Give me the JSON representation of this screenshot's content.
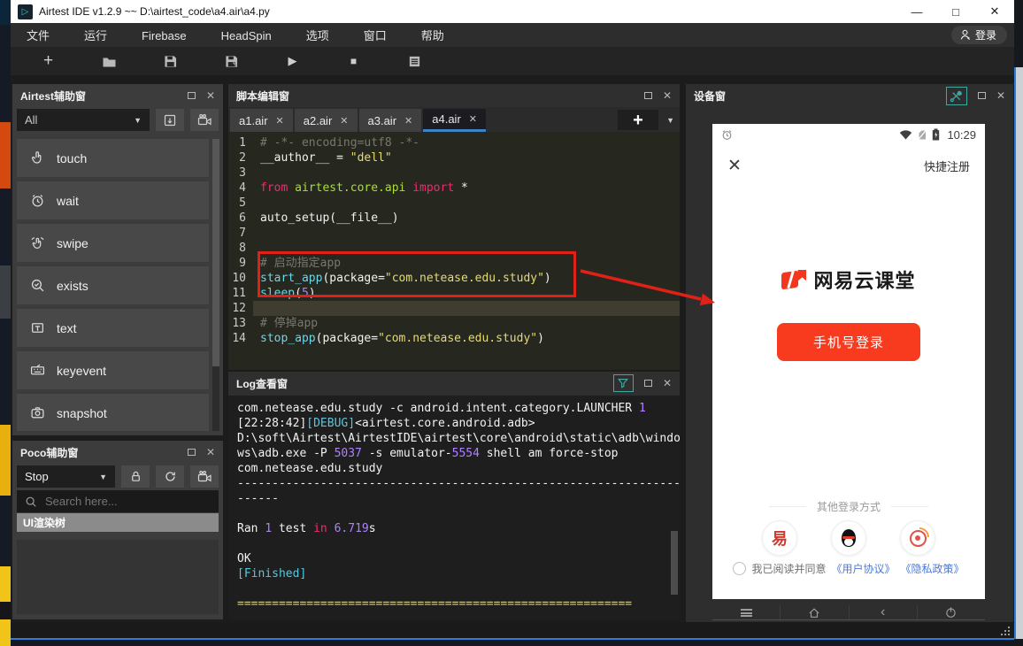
{
  "colors": {
    "accent_red": "#f83b1e",
    "annotation_red": "#df2118",
    "link_blue": "#4b79d9",
    "tab_underline": "#3d84c6",
    "teal_icon": "#3fa8a0"
  },
  "titlebar": {
    "title": "Airtest IDE v1.2.9 ~~ D:\\airtest_code\\a4.air\\a4.py"
  },
  "menu": {
    "items": [
      "文件",
      "运行",
      "Firebase",
      "HeadSpin",
      "选项",
      "窗口",
      "帮助"
    ],
    "login_label": "登录"
  },
  "toolbar": {
    "buttons": [
      "new-script",
      "open-folder",
      "save",
      "save-as",
      "run-script",
      "stop-script",
      "view-report"
    ]
  },
  "airtest_panel": {
    "title": "Airtest辅助窗",
    "filter_value": "All",
    "actions": [
      {
        "label": "touch",
        "icon": "touch-icon"
      },
      {
        "label": "wait",
        "icon": "wait-icon"
      },
      {
        "label": "swipe",
        "icon": "swipe-icon"
      },
      {
        "label": "exists",
        "icon": "exists-icon"
      },
      {
        "label": "text",
        "icon": "text-icon"
      },
      {
        "label": "keyevent",
        "icon": "keyevent-icon"
      },
      {
        "label": "snapshot",
        "icon": "snapshot-icon"
      }
    ]
  },
  "poco_panel": {
    "title": "Poco辅助窗",
    "mode_value": "Stop",
    "search_placeholder": "Search here...",
    "tree_header": "UI渲染树"
  },
  "editor": {
    "title": "脚本编辑窗",
    "tabs": [
      {
        "label": "a1.air",
        "active": false
      },
      {
        "label": "a2.air",
        "active": false
      },
      {
        "label": "a3.air",
        "active": false
      },
      {
        "label": "a4.air",
        "active": true
      }
    ],
    "code": [
      {
        "no": 1,
        "segs": [
          [
            "comment",
            "# -*- encoding=utf8 -*-"
          ]
        ]
      },
      {
        "no": 2,
        "segs": [
          [
            "plain",
            "__author__ = "
          ],
          [
            "str",
            "\"dell\""
          ]
        ]
      },
      {
        "no": 3,
        "segs": []
      },
      {
        "no": 4,
        "segs": [
          [
            "kw",
            "from"
          ],
          [
            "plain",
            " "
          ],
          [
            "mod",
            "airtest.core.api"
          ],
          [
            "plain",
            " "
          ],
          [
            "kw",
            "import"
          ],
          [
            "plain",
            " *"
          ]
        ]
      },
      {
        "no": 5,
        "segs": []
      },
      {
        "no": 6,
        "segs": [
          [
            "plain",
            "auto_setup(__file__)"
          ]
        ]
      },
      {
        "no": 7,
        "segs": []
      },
      {
        "no": 8,
        "segs": []
      },
      {
        "no": 9,
        "segs": [
          [
            "comment",
            "# 启动指定app"
          ]
        ]
      },
      {
        "no": 10,
        "segs": [
          [
            "fn",
            "start_app"
          ],
          [
            "plain",
            "(package="
          ],
          [
            "str",
            "\"com.netease.edu.study\""
          ],
          [
            "plain",
            ")"
          ]
        ]
      },
      {
        "no": 11,
        "segs": [
          [
            "fn",
            "sleep"
          ],
          [
            "plain",
            "("
          ],
          [
            "num",
            "5"
          ],
          [
            "plain",
            ")"
          ]
        ]
      },
      {
        "no": 12,
        "segs": [],
        "hl": true
      },
      {
        "no": 13,
        "segs": [
          [
            "comment",
            "# 停掉app"
          ]
        ]
      },
      {
        "no": 14,
        "segs": [
          [
            "fn",
            "stop_app"
          ],
          [
            "plain",
            "(package="
          ],
          [
            "str",
            "\"com.netease.edu.study\""
          ],
          [
            "plain",
            ")"
          ]
        ]
      }
    ]
  },
  "log": {
    "title": "Log查看窗",
    "lines": [
      [
        [
          "plain",
          "com.netease.edu.study -c android.intent.category.LAUNCHER "
        ],
        [
          "num",
          "1"
        ]
      ],
      [
        [
          "plain",
          "[22:28:42]"
        ],
        [
          "debug",
          "[DEBUG]"
        ],
        [
          "plain",
          "<airtest.core.android.adb>"
        ]
      ],
      [
        [
          "plain",
          "D:\\soft\\Airtest\\AirtestIDE\\airtest\\core\\android\\static\\adb\\windo"
        ]
      ],
      [
        [
          "plain",
          "ws\\adb.exe -P "
        ],
        [
          "num",
          "5037"
        ],
        [
          "plain",
          " -s emulator-"
        ],
        [
          "num",
          "5554"
        ],
        [
          "plain",
          " shell am force-stop"
        ]
      ],
      [
        [
          "plain",
          "com.netease.edu.study"
        ]
      ],
      [
        [
          "plain",
          "----------------------------------------------------------------"
        ]
      ],
      [
        [
          "plain",
          "------"
        ]
      ],
      [],
      [
        [
          "plain",
          "Ran "
        ],
        [
          "num",
          "1"
        ],
        [
          "plain",
          " test "
        ],
        [
          "kw",
          "in"
        ],
        [
          "plain",
          " "
        ],
        [
          "num",
          "6.719"
        ],
        [
          "plain",
          "s"
        ]
      ],
      [],
      [
        [
          "plain",
          "OK"
        ]
      ],
      [
        [
          "debug",
          "[Finished]"
        ]
      ],
      [],
      [
        [
          "sep",
          "========================================================="
        ]
      ]
    ]
  },
  "device": {
    "title": "设备窗",
    "status_time": "10:29",
    "register_label": "快捷注册",
    "brand": "网易云课堂",
    "login_button": "手机号登录",
    "other_login_label": "其他登录方式",
    "providers": [
      {
        "name": "netease",
        "label": "易"
      },
      {
        "name": "qq",
        "label": ""
      },
      {
        "name": "weibo",
        "label": ""
      }
    ],
    "agreement_text": "我已阅读并同意",
    "agreement_links": [
      "《用户协议》",
      "《隐私政策》"
    ],
    "nav_buttons": [
      "menu",
      "home",
      "back",
      "power"
    ]
  }
}
